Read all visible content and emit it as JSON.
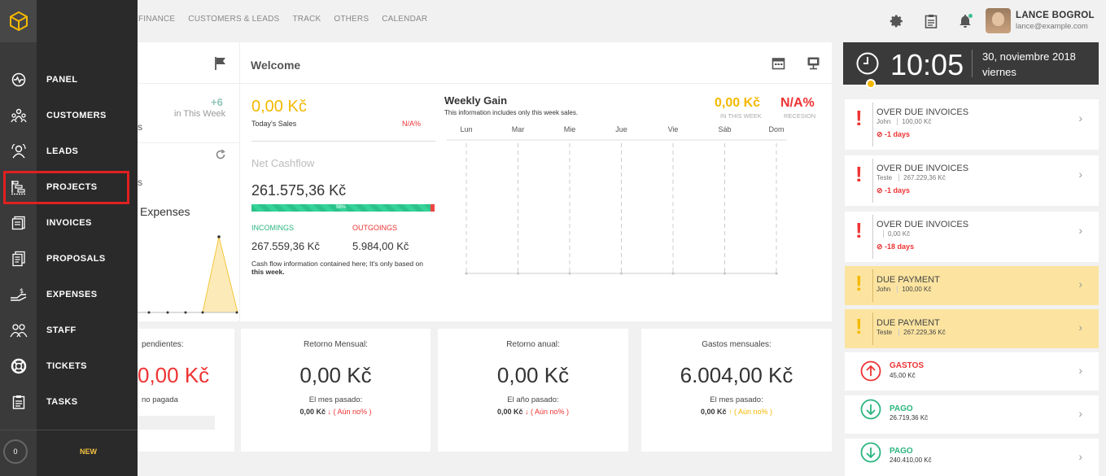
{
  "nav": {
    "links": [
      "FINANCE",
      "CUSTOMERS & LEADS",
      "TRACK",
      "OTHERS",
      "CALENDAR"
    ]
  },
  "user": {
    "name": "LANCE BOGROL",
    "email": "lance@example.com"
  },
  "sidebar": {
    "items": [
      {
        "label": "PANEL",
        "icon": "pulse-icon"
      },
      {
        "label": "CUSTOMERS",
        "icon": "customers-icon"
      },
      {
        "label": "LEADS",
        "icon": "leads-icon"
      },
      {
        "label": "PROJECTS",
        "icon": "projects-icon"
      },
      {
        "label": "INVOICES",
        "icon": "invoices-icon"
      },
      {
        "label": "PROPOSALS",
        "icon": "proposals-icon"
      },
      {
        "label": "EXPENSES",
        "icon": "expenses-icon"
      },
      {
        "label": "STAFF",
        "icon": "staff-icon"
      },
      {
        "label": "TICKETS",
        "icon": "lifebuoy-icon"
      },
      {
        "label": "TASKS",
        "icon": "clipboard-icon"
      }
    ],
    "counter": "0",
    "new_label": "NEW",
    "highlight_color": "#e02020"
  },
  "left_panel": {
    "plus": "+6",
    "in_week": "in This Week",
    "fragment1": "s",
    "fragment2": "s",
    "fragment3": "Expenses"
  },
  "welcome": {
    "title": "Welcome",
    "today_value": "0,00 Kč",
    "today_label": "Today's Sales",
    "today_na": "N/A%",
    "net_cashflow_title": "Net Cashflow",
    "net_cashflow_value": "261.575,36 Kč",
    "cashflow_percent_label": "98%",
    "cashflow_percent": 0.98,
    "incomings_label": "INCOMINGS",
    "outgoings_label": "OUTGOINGS",
    "incomings_value": "267.559,36 Kč",
    "outgoings_value": "5.984,00 Kč",
    "note": "Cash flow information contained here; It's only based on",
    "note_bold": "this week."
  },
  "weekly_gain": {
    "title": "Weekly Gain",
    "subtitle": "This information includes only this week sales.",
    "value": "0,00 Kč",
    "value_label": "IN THIS WEEK",
    "recession_value": "N/A%",
    "recession_label": "RECESION",
    "days": [
      "Lun",
      "Mar",
      "Mie",
      "Jue",
      "Vie",
      "Sáb",
      "Dom"
    ]
  },
  "stats": [
    {
      "title": "pendientes:",
      "value": "0,00 Kč",
      "prev_label": "no pagada",
      "value_color": "#e33",
      "cmp_value": "",
      "cmp_text": ""
    },
    {
      "title": "Retorno Mensual:",
      "value": "0,00 Kč",
      "prev_label": "El mes pasado:",
      "value_color": "#333",
      "cmp_value": "0,00 Kč",
      "cmp_text": "( Aún no% )"
    },
    {
      "title": "Retorno anual:",
      "value": "0,00 Kč",
      "prev_label": "El año pasado:",
      "value_color": "#333",
      "cmp_value": "0,00 Kč",
      "cmp_text": "( Aún no% )"
    },
    {
      "title": "Gastos mensuales:",
      "value": "6.004,00 Kč",
      "prev_label": "El mes pasado:",
      "value_color": "#333",
      "cmp_value": "0,00 Kč",
      "cmp_text": "( Aún no% )"
    }
  ],
  "clock": {
    "time": "10:05",
    "date": "30, noviembre 2018",
    "day": "viernes"
  },
  "notifications": [
    {
      "type": "overdue",
      "title": "OVER DUE INVOICES",
      "name": "John",
      "amount": "100,00 Kč",
      "days": "-1 days"
    },
    {
      "type": "overdue",
      "title": "OVER DUE INVOICES",
      "name": "Teste",
      "amount": "267.229,36 Kč",
      "days": "-1 days"
    },
    {
      "type": "overdue",
      "title": "OVER DUE INVOICES",
      "name": "",
      "amount": "0,00 Kč",
      "days": "-18 days"
    },
    {
      "type": "due",
      "title": "DUE PAYMENT",
      "name": "John",
      "amount": "100,00 Kč"
    },
    {
      "type": "due",
      "title": "DUE PAYMENT",
      "name": "Teste",
      "amount": "267.229,36 Kč"
    },
    {
      "type": "gasto",
      "title": "GASTOS",
      "amount": "45,00 Kč"
    },
    {
      "type": "pago",
      "title": "PAGO",
      "amount": "26.719,36 Kč"
    },
    {
      "type": "pago",
      "title": "PAGO",
      "amount": "240.410,00 Kč"
    }
  ],
  "colors": {
    "accent_yellow": "#f5b800",
    "danger": "#e33",
    "success": "#2bb57f"
  }
}
